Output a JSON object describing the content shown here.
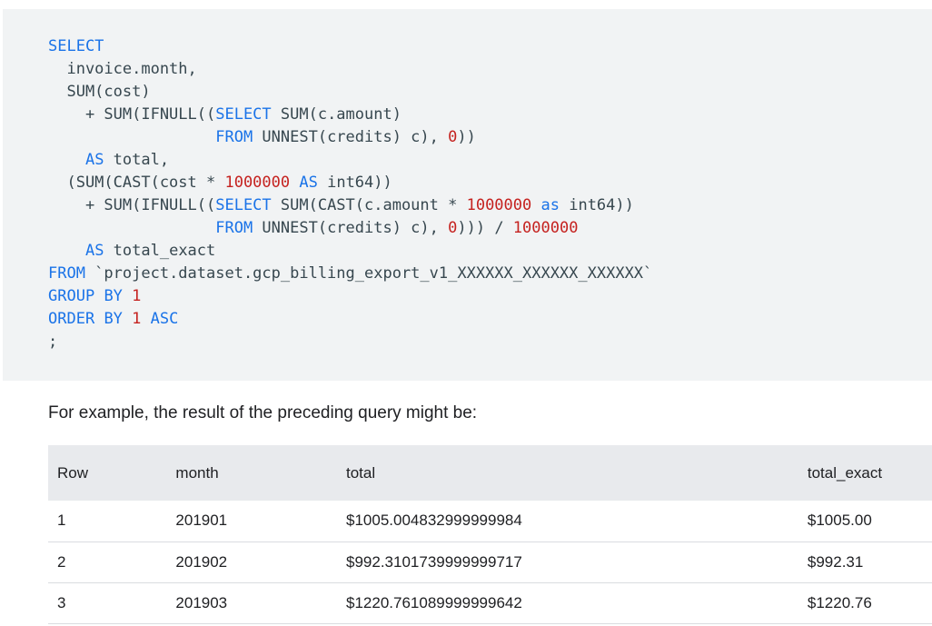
{
  "code": {
    "lines": [
      [
        {
          "t": "SELECT",
          "c": "kw"
        }
      ],
      [
        {
          "t": "  invoice.month,",
          "c": "txt"
        }
      ],
      [
        {
          "t": "  SUM(cost)",
          "c": "txt"
        }
      ],
      [
        {
          "t": "    + SUM(IFNULL((",
          "c": "txt"
        },
        {
          "t": "SELECT",
          "c": "kw"
        },
        {
          "t": " SUM(c.amount)",
          "c": "txt"
        }
      ],
      [
        {
          "t": "                  ",
          "c": "txt"
        },
        {
          "t": "FROM",
          "c": "kw"
        },
        {
          "t": " UNNEST(credits) c), ",
          "c": "txt"
        },
        {
          "t": "0",
          "c": "num"
        },
        {
          "t": "))",
          "c": "txt"
        }
      ],
      [
        {
          "t": "    ",
          "c": "txt"
        },
        {
          "t": "AS",
          "c": "kw"
        },
        {
          "t": " total,",
          "c": "txt"
        }
      ],
      [
        {
          "t": "  (SUM(CAST(cost * ",
          "c": "txt"
        },
        {
          "t": "1000000",
          "c": "num"
        },
        {
          "t": " ",
          "c": "txt"
        },
        {
          "t": "AS",
          "c": "kw"
        },
        {
          "t": " int64))",
          "c": "txt"
        }
      ],
      [
        {
          "t": "    + SUM(IFNULL((",
          "c": "txt"
        },
        {
          "t": "SELECT",
          "c": "kw"
        },
        {
          "t": " SUM(CAST(c.amount * ",
          "c": "txt"
        },
        {
          "t": "1000000",
          "c": "num"
        },
        {
          "t": " ",
          "c": "txt"
        },
        {
          "t": "as",
          "c": "kw"
        },
        {
          "t": " int64))",
          "c": "txt"
        }
      ],
      [
        {
          "t": "                  ",
          "c": "txt"
        },
        {
          "t": "FROM",
          "c": "kw"
        },
        {
          "t": " UNNEST(credits) c), ",
          "c": "txt"
        },
        {
          "t": "0",
          "c": "num"
        },
        {
          "t": "))) / ",
          "c": "txt"
        },
        {
          "t": "1000000",
          "c": "num"
        }
      ],
      [
        {
          "t": "    ",
          "c": "txt"
        },
        {
          "t": "AS",
          "c": "kw"
        },
        {
          "t": " total_exact",
          "c": "txt"
        }
      ],
      [
        {
          "t": "FROM",
          "c": "kw"
        },
        {
          "t": " `project.dataset.gcp_billing_export_v1_XXXXXX_XXXXXX_XXXXXX`",
          "c": "txt"
        }
      ],
      [
        {
          "t": "GROUP",
          "c": "kw"
        },
        {
          "t": " ",
          "c": "txt"
        },
        {
          "t": "BY",
          "c": "kw"
        },
        {
          "t": " ",
          "c": "txt"
        },
        {
          "t": "1",
          "c": "num"
        }
      ],
      [
        {
          "t": "ORDER",
          "c": "kw"
        },
        {
          "t": " ",
          "c": "txt"
        },
        {
          "t": "BY",
          "c": "kw"
        },
        {
          "t": " ",
          "c": "txt"
        },
        {
          "t": "1",
          "c": "num"
        },
        {
          "t": " ",
          "c": "txt"
        },
        {
          "t": "ASC",
          "c": "kw"
        }
      ],
      [
        {
          "t": ";",
          "c": "txt"
        }
      ]
    ]
  },
  "intro_text": "For example, the result of the preceding query might be:",
  "table": {
    "headers": [
      "Row",
      "month",
      "total",
      "total_exact"
    ],
    "rows": [
      [
        "1",
        "201901",
        "$1005.004832999999984",
        "$1005.00"
      ],
      [
        "2",
        "201902",
        "$992.3101739999999717",
        "$992.31"
      ],
      [
        "3",
        "201903",
        "$1220.761089999999642",
        "$1220.76"
      ]
    ]
  },
  "colors": {
    "keyword": "#1a73e8",
    "number": "#c5221f",
    "code_background": "#f1f3f4",
    "table_header_background": "#e8eaed"
  }
}
